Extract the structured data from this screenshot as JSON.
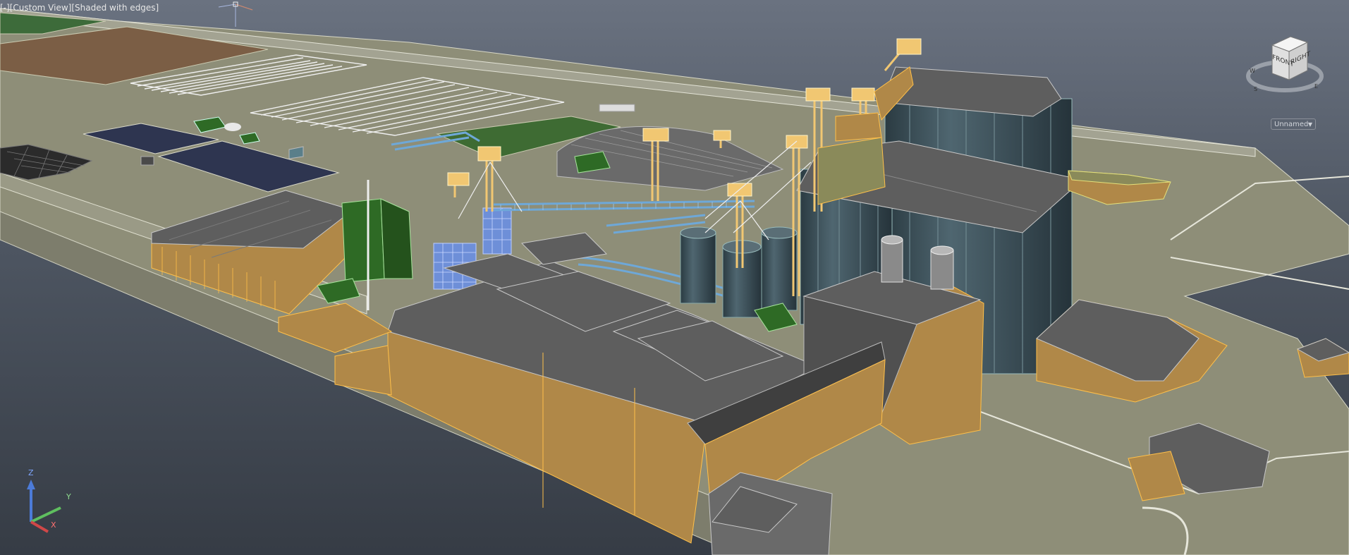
{
  "viewport": {
    "control_label": "[-]",
    "view_label": "[Custom View]",
    "visual_style_label": "[Shaded with edges]"
  },
  "viewcube": {
    "face_front": "FRONT",
    "face_right": "RIGHT",
    "compass_east": "E",
    "compass_south": "S",
    "compass_west": "W"
  },
  "named_view": {
    "value": "Unnamed",
    "dropdown_icon": "chevron-down-icon"
  },
  "ucs": {
    "z_label": "Z",
    "y_label": "Y",
    "x_label": "X"
  },
  "colors": {
    "background_top": "#6a7280",
    "background_bottom": "#363c45",
    "ground": "#8e8e78",
    "building_wall": "#b08848",
    "edge_highlight": "#ffc04a",
    "roof": "#5e5e5e",
    "silo": "#3c5058",
    "green_structure": "#2e6a25",
    "conveyor": "#6ea8d8",
    "tower": "#f1c772",
    "water_pond": "#2e3550"
  }
}
